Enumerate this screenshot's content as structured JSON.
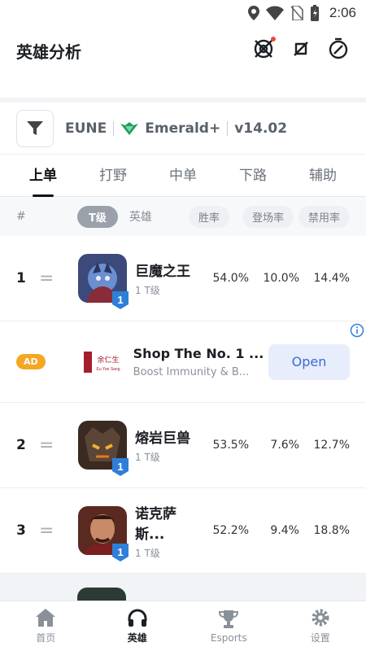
{
  "status": {
    "time": "2:06"
  },
  "header": {
    "title": "英雄分析"
  },
  "filters": {
    "region": "EUNE",
    "rank": "Emerald+",
    "version": "v14.02"
  },
  "tabs": [
    {
      "label": "上单",
      "active": true
    },
    {
      "label": "打野",
      "active": false
    },
    {
      "label": "中单",
      "active": false
    },
    {
      "label": "下路",
      "active": false
    },
    {
      "label": "辅助",
      "active": false
    }
  ],
  "columns": {
    "hash": "#",
    "tier": "T级",
    "hero": "英雄",
    "win": "胜率",
    "pick": "登场率",
    "ban": "禁用率"
  },
  "rows": [
    {
      "rank": "1",
      "trend": "=",
      "name": "巨魔之王",
      "tier": "1 T级",
      "win": "54.0%",
      "pick": "10.0%",
      "ban": "14.4%",
      "badge": "1"
    },
    {
      "rank": "2",
      "trend": "=",
      "name": "熔岩巨兽",
      "tier": "1 T级",
      "win": "53.5%",
      "pick": "7.6%",
      "ban": "12.7%",
      "badge": "1"
    },
    {
      "rank": "3",
      "trend": "=",
      "name": "诺克萨斯...",
      "tier": "1 T级",
      "win": "52.2%",
      "pick": "9.4%",
      "ban": "18.8%",
      "badge": "1"
    }
  ],
  "ad": {
    "badge": "AD",
    "title": "Shop The No. 1 ...",
    "subtitle": "Boost Immunity & B...",
    "button": "Open",
    "logo_text": "余仁生",
    "logo_sub": "Eu Yan Sang"
  },
  "nav": [
    {
      "label": "首页",
      "icon": "home-icon",
      "active": false
    },
    {
      "label": "英雄",
      "icon": "headphones-icon",
      "active": true
    },
    {
      "label": "Esports",
      "icon": "trophy-icon",
      "active": false
    },
    {
      "label": "设置",
      "icon": "gear-icon",
      "active": false
    }
  ],
  "colors": {
    "accent": "#1c1f24",
    "ad_badge": "#f5a623",
    "tier_badge": "#2f7fd8",
    "open_button": "#3b6ad8",
    "emerald": "#1f9e5a"
  }
}
